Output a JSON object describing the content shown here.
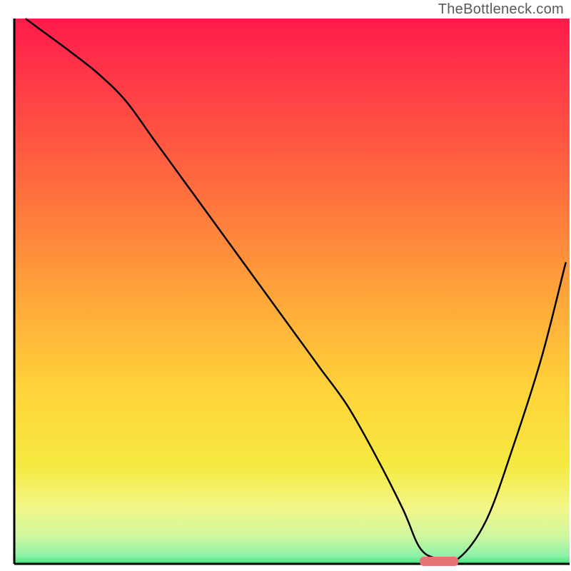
{
  "watermark": "TheBottleneck.com",
  "chart_data": {
    "type": "line",
    "title": "",
    "xlabel": "",
    "ylabel": "",
    "grid": false,
    "legend": false,
    "xlim": [
      0,
      100
    ],
    "ylim": [
      0,
      100
    ],
    "x": [
      2,
      6,
      10,
      15,
      20,
      25,
      30,
      35,
      40,
      45,
      50,
      55,
      60,
      65,
      70,
      73,
      76,
      80,
      85,
      90,
      95,
      99
    ],
    "values": [
      100,
      97,
      94,
      90,
      85,
      78,
      71,
      64,
      57,
      50,
      43,
      36,
      29,
      20,
      10,
      3,
      1,
      1,
      8,
      22,
      38,
      54
    ],
    "annotations": [
      {
        "kind": "marker",
        "shape": "rounded-bar",
        "color": "#e57373",
        "x_start": 73,
        "x_end": 80,
        "y": 0.5
      }
    ],
    "background_gradient": {
      "direction": "vertical",
      "stops": [
        {
          "offset": 0.0,
          "color": "#ff1a4b"
        },
        {
          "offset": 0.12,
          "color": "#ff3b47"
        },
        {
          "offset": 0.3,
          "color": "#ff6a3e"
        },
        {
          "offset": 0.5,
          "color": "#ffa33a"
        },
        {
          "offset": 0.68,
          "color": "#ffd33a"
        },
        {
          "offset": 0.82,
          "color": "#f6ea41"
        },
        {
          "offset": 0.9,
          "color": "#f2f78a"
        },
        {
          "offset": 0.95,
          "color": "#cdf7a0"
        },
        {
          "offset": 0.985,
          "color": "#8ef2a8"
        },
        {
          "offset": 1.0,
          "color": "#3fe57e"
        }
      ]
    },
    "axes_color": "#000000"
  }
}
